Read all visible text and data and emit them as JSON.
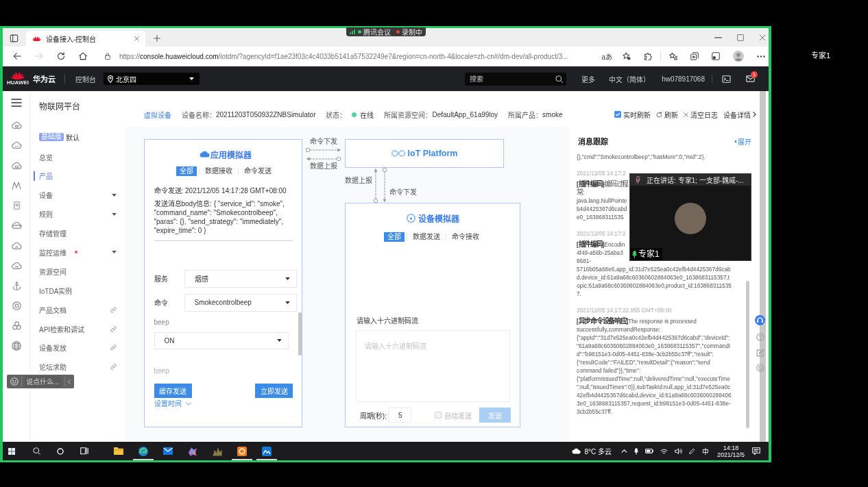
{
  "meeting_bar": {
    "app": "腾讯会议",
    "recording": "录制中"
  },
  "browser": {
    "tabs": [
      {
        "title": "设备接入-控制台",
        "selected": true
      }
    ],
    "nav_buttons": [
      {
        "kind": "back",
        "disabled": false
      },
      {
        "kind": "forward",
        "disabled": true
      },
      {
        "kind": "refresh",
        "disabled": false
      },
      {
        "kind": "home",
        "disabled": false
      }
    ],
    "address": {
      "scheme": "https://",
      "host": "console.huaweicloud.com",
      "path": "/iotdm/?agencyId=f1ae23f03c4c4033b5141a57532249e7&region=cn-north-4&locale=zh-cn#/dm-dev/all-product/3..."
    },
    "read_aloud": "aあ"
  },
  "console_header": {
    "logo_text": "HUAWEI",
    "brand": "华为云",
    "console": "控制台",
    "region": "北京四",
    "search": {
      "placeholder": "搜索"
    },
    "links": [
      "更多",
      "中文（简体）",
      "hw078917068"
    ],
    "mail_badge": "1"
  },
  "sidebar": {
    "title": "物联网平台",
    "edition_badge": "基础版",
    "edition": "默认",
    "items": [
      {
        "label": "总览",
        "kind": "plain",
        "selected": false,
        "dot": false
      },
      {
        "label": "产品",
        "kind": "plain",
        "selected": true,
        "dot": false
      },
      {
        "label": "设备",
        "kind": "group",
        "selected": false,
        "dot": false
      },
      {
        "label": "规则",
        "kind": "group",
        "selected": false,
        "dot": false
      },
      {
        "label": "存储管理",
        "kind": "plain",
        "selected": false,
        "dot": false
      },
      {
        "label": "监控运维",
        "kind": "group",
        "selected": false,
        "dot": true
      },
      {
        "label": "资源空间",
        "kind": "plain",
        "selected": false,
        "dot": false
      },
      {
        "label": "IoTDA实例",
        "kind": "plain",
        "selected": false,
        "dot": false
      },
      {
        "label": "产品文档",
        "kind": "external",
        "selected": false,
        "dot": false
      },
      {
        "label": "API检索和调试",
        "kind": "external",
        "selected": false,
        "dot": false
      },
      {
        "label": "设备发放",
        "kind": "external",
        "selected": false,
        "dot": false
      },
      {
        "label": "论坛求助",
        "kind": "external",
        "selected": false,
        "dot": false
      }
    ]
  },
  "device_bar": {
    "virtual_device": "虚拟设备",
    "name": {
      "label": "设备名称：",
      "value": "20211203T050932ZNBSimulator"
    },
    "status": {
      "label": "状态：",
      "value": "在线",
      "online": true
    },
    "space": {
      "label": "所属资源空间：",
      "value": "DefaultApp_61a99loy"
    },
    "product": {
      "label": "所属产品：",
      "value": "smoke"
    },
    "auto_refresh": {
      "label": "实时刷新",
      "checked": true
    },
    "actions": [
      {
        "kind": "refresh",
        "label": "刷新"
      },
      {
        "kind": "clear",
        "label": "清空日志"
      },
      {
        "kind": "details",
        "label": "设备详情"
      }
    ]
  },
  "app_simulator": {
    "title": "应用模拟器",
    "tabs": [
      {
        "label": "全部",
        "selected": true
      },
      {
        "label": "数据接收",
        "selected": false
      },
      {
        "label": "命令发送",
        "selected": false
      }
    ],
    "log": [
      {
        "heading": "命令发送: 2021/12/05 14:17:28 GMT+08:00",
        "body": "发送消息body信息: { \"service_id\": \"smoke\", \"command_name\": \"Smokecontrolbeep\", \"paras\": {}, \"send_strategy\": \"immediately\", \"expire_time\": 0 }"
      }
    ],
    "fields": [
      {
        "label": "服务",
        "value": "烟感"
      },
      {
        "label": "命令",
        "value": "Smokecontrolbeep"
      }
    ],
    "params": [
      {
        "label": "beep",
        "value": "ON"
      },
      {
        "label": "beep"
      }
    ],
    "buttons": [
      "缓存发送",
      "立即发送"
    ],
    "schedule": "设置时间"
  },
  "app_link": {
    "down": "命令下发",
    "up": "数据上报"
  },
  "platform": {
    "title": "IoT Platform"
  },
  "device_link": {
    "up": "数据上报",
    "down": "命令下发"
  },
  "device_simulator": {
    "title": "设备模拟器",
    "tabs": [
      {
        "label": "全部",
        "selected": true
      },
      {
        "label": "数据发送",
        "selected": false
      },
      {
        "label": "命令接收",
        "selected": false
      }
    ],
    "stream_label": "请输入十六进制码流",
    "stream_input": {
      "placeholder": "请输入十六进制码流"
    },
    "period": {
      "label": "周期(秒):",
      "value": "5"
    },
    "auto_send": {
      "label": "自动发送",
      "checked": false,
      "disabled": true
    },
    "send": {
      "label": "发送",
      "disabled": true
    }
  },
  "message_trace": {
    "title": "消息跟踪",
    "expand": "展开",
    "entries": [
      {
        "lines": [
          "{},\"cmd\":\"Smokecontrolbeep\",\"hasMore\":0,\"mid\":2}."
        ]
      },
      {
        "time": "2021/12/05 14:17:2",
        "lines": [
          "**[插件编码]**编码过程",
          "常:",
          "java.lang.NullPointe",
          "b4d4425367d6cabd",
          "e0_163868311535"
        ]
      },
      {
        "time": "2021/12/05 14:17:2",
        "lines": [
          "**[插件编码]**Encodin",
          "4f49-a56b-25aba3",
          "8681-",
          "5716b05a68e6,app_id:31d7e525ea0c42efb4d4425367d6cabd,device_id:61a9a68c60360602884063e0_1638683115357,topic:61a9a68c60360602884063e0,product_id:1638683115357."
        ]
      },
      {
        "time": "2021/12/05 14:17:22.955 GMT+08:00",
        "lines": [
          "**[异步命令设备响应]**The response is processed successfully,commandResponse: {\"appId\":\"31d7e525ea0c42efb4d4425367d6cabd\",\"deviceId\":\"61a9a68c60360602884063e0_1638683115357\",\"commandId\":\"b98151e3-0d05-4451-838e-3cb2b55c37ff\",\"result\":{\"resultCode\":\"FAILED\",\"resultDetail\":{\"reason\":\"send command failed\"}},\"time\":{\"platformIssuedTime\":null,\"deliveredTime\":null,\"executeTime\":null,\"issuedTimes\":0}},subTaskId:null,app_id:31d7e525ea0c42efb4d4425367d6cabd,device_id:61a9a68c60360602884063e0_1638683115357,request_id:b98151e3-0d05-4451-838e-3cb2b55c37ff."
        ]
      }
    ]
  },
  "speaker_window": {
    "status": "正在讲话: 专家1; 一支部-魏威-...",
    "name": "专家1",
    "self_muted": true,
    "speaking": true
  },
  "chat_bar": {
    "placeholder": "说点什么..."
  },
  "taskbar": {
    "apps": [
      {
        "kind": "folder",
        "running": false
      },
      {
        "kind": "browser",
        "running": true
      },
      {
        "kind": "mail",
        "running": false
      },
      {
        "kind": "palette",
        "running": false
      },
      {
        "kind": "game",
        "running": false
      },
      {
        "kind": "orange",
        "running": true
      },
      {
        "kind": "wave",
        "running": true
      }
    ],
    "weather": "8°C 多云",
    "ime": "中",
    "time": "14:18",
    "date": "2021/12/5"
  },
  "side_label": "专家1"
}
